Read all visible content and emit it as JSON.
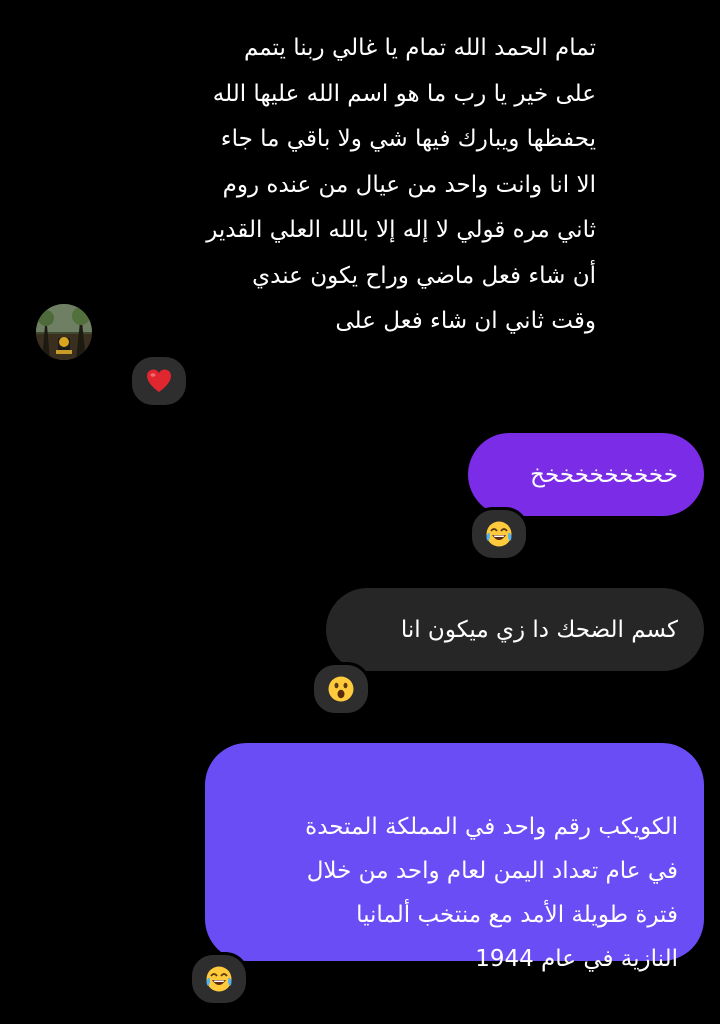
{
  "conversation": {
    "incoming_message": "تمام الحمد الله تمام يا غالي ربنا يتمم\nعلى خير يا رب ما هو اسم الله عليها الله\nيحفظها ويبارك فيها شي ولا باقي ما جاء\nالا انا وانت واحد من عيال من عنده روم\nثاني مره قولي لا إله إلا بالله العلي القدير\nأن شاء فعل ماضي وراح يكون عندي\nوقت ثاني ان شاء فعل على",
    "messages": [
      {
        "text": "خخخخخخخخخخ",
        "reaction_icon": "face-with-tears-of-joy-icon"
      },
      {
        "text": "كسم الضحك دا زي ميكون انا",
        "reaction_icon": "astonished-face-icon"
      },
      {
        "text": "الكويكب رقم واحد في المملكة المتحدة\nفي عام تعداد اليمن لعام واحد من خلال\nفترة طويلة الأمد مع منتخب ألمانيا\nالنازية في عام 1944",
        "reaction_icon": "face-with-tears-of-joy-icon"
      }
    ],
    "incoming_reaction_icon": "red-heart-icon"
  },
  "colors": {
    "background": "#000000",
    "outgoing_purple": "#7a2ce6",
    "outgoing_gray": "#262626",
    "outgoing_violet": "#6a4df4",
    "reaction_pill": "#2e2e2e"
  }
}
